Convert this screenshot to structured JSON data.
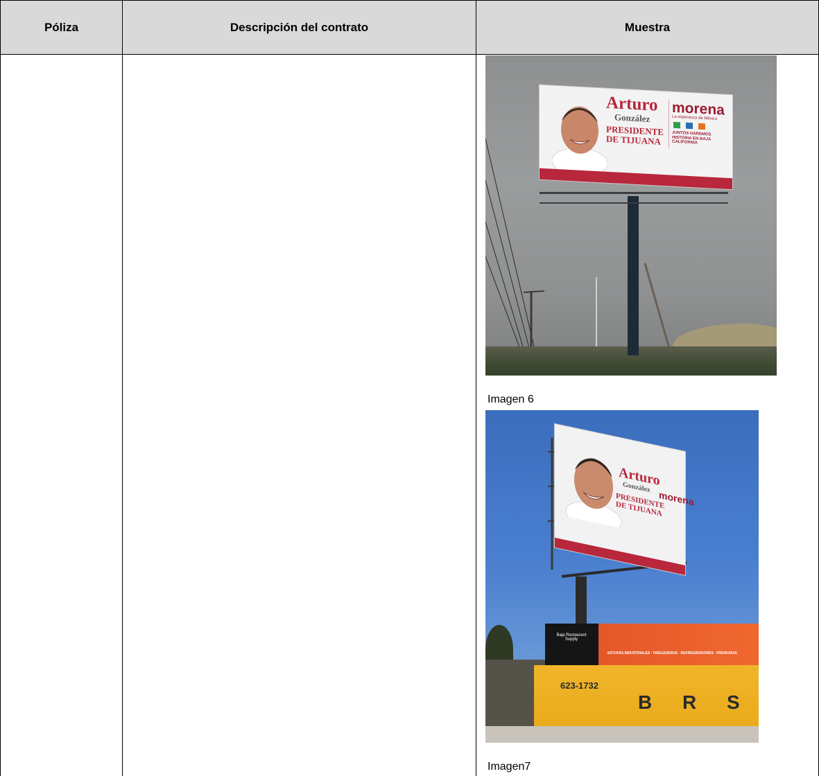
{
  "table": {
    "headers": [
      "Póliza",
      "Descripción del contrato",
      "Muestra"
    ]
  },
  "images": [
    {
      "caption": "Imagen 6",
      "billboard": {
        "name_first": "Arturo",
        "name_last": "González",
        "role_line1": "PRESIDENTE",
        "role_line2": "DE TIJUANA",
        "party": "morena",
        "party_slogan": "La esperanza de México",
        "footer_text": "JUNTOS HAREMOS HISTORIA EN BAJA CALIFORNIA"
      }
    },
    {
      "caption": "Imagen7",
      "billboard": {
        "name_first": "Arturo",
        "name_last": "González",
        "role_line1": "PRESIDENTE",
        "role_line2": "DE TIJUANA",
        "party": "morena"
      },
      "shop": {
        "name": "Baja Restaurant Supply",
        "phone": "623-1732",
        "sign_items": "ESTUFAS INDUSTRIALES · FREGADEROS · REFRIGERADORES · FREIDORAS",
        "logo_letters": "B R S"
      }
    }
  ],
  "colors": {
    "header_bg": "#d9d9d9",
    "border": "#000000",
    "billboard_red": "#b8273b"
  }
}
